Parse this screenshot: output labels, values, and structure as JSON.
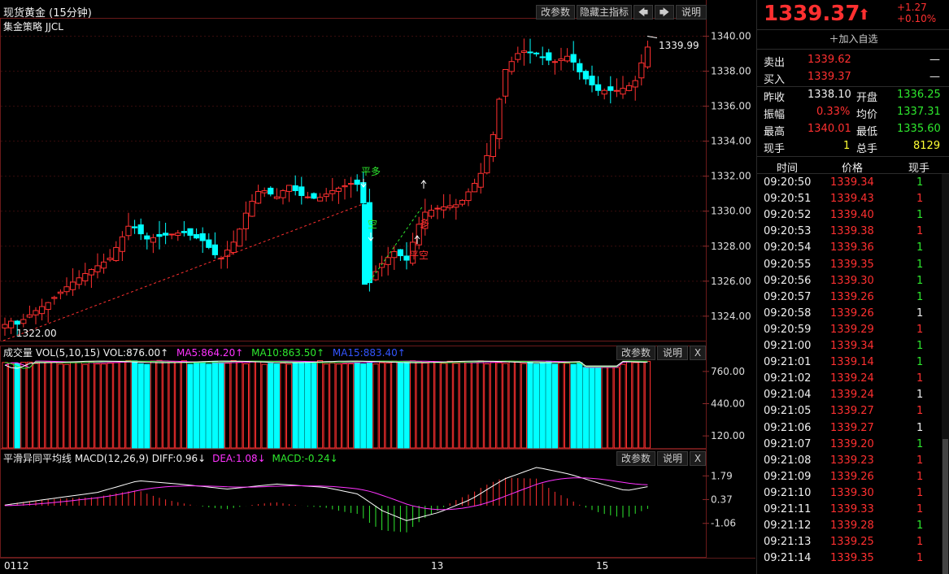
{
  "chart": {
    "title": "现货黄金 (15分钟)",
    "strategy": "集金策略 JJCL",
    "buttons": {
      "params": "改参数",
      "hide": "隐藏主指标",
      "left": "🡄",
      "right": "🡆",
      "help": "说明",
      "close": "X"
    },
    "y_labels": [
      "1340.00",
      "1338.00",
      "1336.00",
      "1334.00",
      "1332.00",
      "1330.00",
      "1328.00",
      "1326.00",
      "1324.00"
    ],
    "high_label": "1339.99",
    "low_label": "1322.00",
    "signals": {
      "close_long": "平多",
      "short": "空",
      "long": "多",
      "close_short": "平空"
    },
    "x_labels": [
      "0112",
      "13",
      "15"
    ],
    "colors": {
      "up": "#ff3030",
      "down": "#00ffff"
    }
  },
  "volume": {
    "title": "成交量 VOL(5,10,15) VOL:876.00↑",
    "ma5": "MA5:864.20↑",
    "ma10": "MA10:863.50↑",
    "ma15": "MA15:883.40↑",
    "y_labels": [
      "760.00",
      "440.00",
      "120.00"
    ]
  },
  "macd": {
    "title": "平滑异同平均线 MACD(12,26,9) DIFF:0.96↓",
    "dea": "DEA:1.08↓",
    "macd": "MACD:-0.24↓",
    "y_labels": [
      "1.79",
      "0.37",
      "-1.06"
    ]
  },
  "quote": {
    "price": "1339.37",
    "arrow": "⬆",
    "change": "+1.27",
    "change_pct": "+0.10%",
    "add_watch": "加入自选",
    "rows": [
      {
        "label": "卖出",
        "value": "1339.62",
        "extra": "—"
      },
      {
        "label": "买入",
        "value": "1339.37",
        "extra": "—"
      }
    ],
    "stats": [
      {
        "l1": "昨收",
        "v1": "1338.10",
        "l2": "开盘",
        "v2": "1336.25"
      },
      {
        "l1": "振幅",
        "v1": "0.33%",
        "l2": "均价",
        "v2": "1337.31"
      },
      {
        "l1": "最高",
        "v1": "1340.01",
        "l2": "最低",
        "v2": "1335.60"
      },
      {
        "l1": "现手",
        "v1": "1",
        "l2": "总手",
        "v2": "8129"
      }
    ],
    "tick_headers": [
      "时间",
      "价格",
      "现手"
    ],
    "ticks": [
      {
        "time": "09:20:50",
        "price": "1339.34",
        "vol": "1"
      },
      {
        "time": "09:20:51",
        "price": "1339.43",
        "vol": "1"
      },
      {
        "time": "09:20:52",
        "price": "1339.40",
        "vol": "1"
      },
      {
        "time": "09:20:53",
        "price": "1339.38",
        "vol": "1"
      },
      {
        "time": "09:20:54",
        "price": "1339.36",
        "vol": "1"
      },
      {
        "time": "09:20:55",
        "price": "1339.35",
        "vol": "1"
      },
      {
        "time": "09:20:56",
        "price": "1339.30",
        "vol": "1"
      },
      {
        "time": "09:20:57",
        "price": "1339.26",
        "vol": "1"
      },
      {
        "time": "09:20:58",
        "price": "1339.26",
        "vol": "1"
      },
      {
        "time": "09:20:59",
        "price": "1339.29",
        "vol": "1"
      },
      {
        "time": "09:21:00",
        "price": "1339.34",
        "vol": "1"
      },
      {
        "time": "09:21:01",
        "price": "1339.14",
        "vol": "1"
      },
      {
        "time": "09:21:02",
        "price": "1339.24",
        "vol": "1"
      },
      {
        "time": "09:21:04",
        "price": "1339.24",
        "vol": "1"
      },
      {
        "time": "09:21:05",
        "price": "1339.27",
        "vol": "1"
      },
      {
        "time": "09:21:06",
        "price": "1339.27",
        "vol": "1"
      },
      {
        "time": "09:21:07",
        "price": "1339.20",
        "vol": "1"
      },
      {
        "time": "09:21:08",
        "price": "1339.23",
        "vol": "1"
      },
      {
        "time": "09:21:09",
        "price": "1339.26",
        "vol": "1"
      },
      {
        "time": "09:21:10",
        "price": "1339.30",
        "vol": "1"
      },
      {
        "time": "09:21:11",
        "price": "1339.33",
        "vol": "1"
      },
      {
        "time": "09:21:12",
        "price": "1339.28",
        "vol": "1"
      },
      {
        "time": "09:21:13",
        "price": "1339.25",
        "vol": "1"
      },
      {
        "time": "09:21:14",
        "price": "1339.35",
        "vol": "1"
      }
    ],
    "tick_vol_colors": [
      "green",
      "red",
      "green",
      "red",
      "green",
      "green",
      "green",
      "green",
      "white",
      "red",
      "green",
      "green",
      "red",
      "white",
      "red",
      "white",
      "green",
      "red",
      "red",
      "red",
      "red",
      "green",
      "red",
      "red"
    ]
  }
}
